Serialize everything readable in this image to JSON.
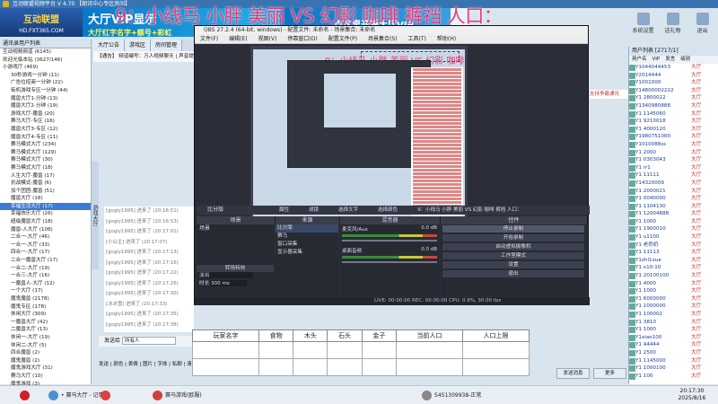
{
  "app": {
    "title": "互动联盟视频平台 V 4.70 【朗讯中心专区房间】"
  },
  "banner": {
    "logo": "互动联盟",
    "logo_sub": "HD.FXT365.COM",
    "ad1": "大厅VIP显示",
    "ad1_sub": "大厅红字名字+靓号+彩虹",
    "ad2": "点这里开通大厅VIP"
  },
  "overlay_caption": "9：小线马 小胖 美丽 VS 幻影 咖啡 裤裆 人口：",
  "top_tools": [
    {
      "label": "系统设置"
    },
    {
      "label": "送礼物"
    },
    {
      "label": "退出"
    }
  ],
  "tree": {
    "header": "通讯录用户列表",
    "rows": [
      "互动视频频道 (6145)",
      "欢迎光临本站 (3627/146)",
      "小游戏厅 (469)",
      "30秒游戏一分钟 (11)",
      "广告位招商一分钟 (22)",
      "街机游戏专区一分钟 (44)",
      "魔兽大厅1-分钟 (13)",
      "魔兽大厅2-分钟 (19)",
      "游戏大厅-魔兽 (20)",
      "赛马大厅-专区 (16)",
      "魔兽大厅3-专区 (12)",
      "魔兽大厅4-专区 (11)",
      "赛马模式大厅 (234)",
      "赛马模式大厅 (129)",
      "赛马模式大厅 (30)",
      "赛马模式大厅 (18)",
      "人生大厅-魔兽 (17)",
      "抗战模式-魔兽 (6)",
      "加个团团-魔兽 (51)",
      "魔兽大厅 (18)",
      "幸福生活大厅 (17)",
      "幸福快乐大厅 (26)",
      "超级魔兽大厅 (18)",
      "魔兽-人大厅 (106)",
      "二合一-大厅 (46)",
      "一合一-大厅 (33)",
      "四合一-大厅 (17)",
      "二合一魔兽大厅 (17)",
      "一合二-大厅 (19)",
      "一合三-大厅 (16)",
      "一魔兽人-大厅 (12)",
      "一个大厅 (17)",
      "魔鬼魔兽 (2178)",
      "魔鬼专区 (178)",
      "休闲大厅 (309)",
      "一魔兽大厅 (42)",
      "二魔兽大厅 (13)",
      "休闲一-大厅 (19)",
      "休闲二-大厅 (5)",
      "四合魔兽 (2)",
      "魔鬼魔兽 (2)",
      "魔鬼游戏大厅 (31)",
      "赛马大厅 (10)",
      "魔鬼游戏 (3)"
    ],
    "vertical_tab": "游戏大厅"
  },
  "tabs": [
    "大厅公告",
    "游戏区",
    "房间管理"
  ],
  "info_bar": "【通告】 频道编号：万人视频聊天 | 声音提示：轻声...",
  "chat_log": [
    "[gogly1995] 进来了 (20:16:51)",
    "[gogly1995] 进来了 (20:16:53)",
    "[gogly1995] 进来了 (20:17:01)",
    "[小公主] 进来了 (20:17:07)",
    "[gogly1995] 进来了 (20:17:13)",
    "[gogly1995] 进来了 (20:17:16)",
    "[gogly1995] 进来了 (20:17:22)",
    "[gogly1995] 进来了 (20:17:26)",
    "[gogly1995] 进来了 (20:17:30)",
    "[冰冰雪] 进来了 (20:17:33)",
    "[gogly1995] 进来了 (20:17:35)",
    "[gogly1995] 进来了 (20:17:38)"
  ],
  "chat_input": {
    "label": "发送给",
    "target": "所有人"
  },
  "chat_bottom": "发送 | 颜色 | 表情 | 图片 | 字体 | 私聊 | 清屏",
  "obs": {
    "title": "OBS 27.2.4 (64-bit, windows) - 配置文件: 未命名 - 场景集合: 未命名",
    "menu": [
      "文件(F)",
      "编辑(E)",
      "视图(V)",
      "停靠窗口(D)",
      "配置文件(P)",
      "场景集合(S)",
      "工具(T)",
      "帮助(H)"
    ],
    "source_label": "比分版",
    "props": [
      "属性",
      "滤镜",
      "选择文字",
      "选择颜色"
    ],
    "text_value": "9：小线马 小胖 美丽 VS 幻影 咖啡 裤裆 人口：",
    "docks": {
      "scenes": "场景",
      "sources": "来源",
      "mixer": "混音器",
      "controls": "控件"
    },
    "scenes": [
      "场景"
    ],
    "sources": [
      "比分版",
      "赛马",
      "窗口采集",
      "显示器采集"
    ],
    "mixer": [
      {
        "name": "麦克风/Aux",
        "db": "0.0 dB"
      },
      {
        "name": "桌面音频",
        "db": "0.0 dB"
      }
    ],
    "controls": [
      "停止录制",
      "开始录制",
      "启动虚拟摄像机",
      "工作室模式",
      "设置",
      "退出"
    ],
    "transition": {
      "head": "转场特效",
      "value": "淡出",
      "duration_label": "时长",
      "duration": "300 ms"
    },
    "status": "LIVE: 00:00:00   REC: 00:00:00   CPU: 0.9%, 30.00 fps"
  },
  "table": {
    "headers": [
      "玩家名字",
      "食物",
      "木头",
      "石头",
      "金子",
      "当前人口",
      "人口上限"
    ]
  },
  "right_panel": {
    "header": "用户列表 [2717/1]",
    "cols": [
      "用户名",
      "VIP",
      "发言",
      "级别"
    ],
    "notice": "支持争霸通讯",
    "users": [
      {
        "name": "Y1044044453",
        "tag": "大厅"
      },
      {
        "name": "Y2014444",
        "tag": "大厅"
      },
      {
        "name": "Y1001000",
        "tag": "大厅"
      },
      {
        "name": "Y14800002222",
        "tag": "大厅"
      },
      {
        "name": "Y1 2800022",
        "tag": "大厅"
      },
      {
        "name": "Y1340980888",
        "tag": "大厅"
      },
      {
        "name": "Y1 1145060",
        "tag": "大厅"
      },
      {
        "name": "Y1 9210018",
        "tag": "大厅"
      },
      {
        "name": "Y1 4000120",
        "tag": "大厅"
      },
      {
        "name": "Y1980751000",
        "tag": "大厅"
      },
      {
        "name": "Y1010088ss",
        "tag": "大厅"
      },
      {
        "name": "Y1 2000",
        "tag": "大厅"
      },
      {
        "name": "Y1 0303043",
        "tag": "大厅"
      },
      {
        "name": "Y1 rr1",
        "tag": "大厅"
      },
      {
        "name": "Y1 11111",
        "tag": "大厅"
      },
      {
        "name": "Y14320009",
        "tag": "大厅"
      },
      {
        "name": "Y1 2000021",
        "tag": "大厅"
      },
      {
        "name": "Y1 0040000",
        "tag": "大厅"
      },
      {
        "name": "Y1 1104130",
        "tag": "大厅"
      },
      {
        "name": "Y1 12004888",
        "tag": "大厅"
      },
      {
        "name": "Y1 1000",
        "tag": "大厅"
      },
      {
        "name": "Y1 1900010",
        "tag": "大厅"
      },
      {
        "name": "Y1 u1100",
        "tag": "大厅"
      },
      {
        "name": "Y1 老奶奶",
        "tag": "大厅"
      },
      {
        "name": "Y1 11113",
        "tag": "大厅"
      },
      {
        "name": "Y1zhi1xue",
        "tag": "大厅"
      },
      {
        "name": "Y1 x10-10",
        "tag": "大厅"
      },
      {
        "name": "Y1 20100100",
        "tag": "大厅"
      },
      {
        "name": "Y1 4000",
        "tag": "大厅"
      },
      {
        "name": "Y1 1000",
        "tag": "大厅"
      },
      {
        "name": "Y1 6000000",
        "tag": "大厅"
      },
      {
        "name": "Y1 1000000",
        "tag": "大厅"
      },
      {
        "name": "Y1 100002",
        "tag": "大厅"
      },
      {
        "name": "Y1 3810",
        "tag": "大厅"
      },
      {
        "name": "Y1 1000",
        "tag": "大厅"
      },
      {
        "name": "Y1xiao100",
        "tag": "大厅"
      },
      {
        "name": "Y1 44444",
        "tag": "大厅"
      },
      {
        "name": "Y1 2500",
        "tag": "大厅"
      },
      {
        "name": "Y1 1145000",
        "tag": "大厅"
      },
      {
        "name": "Y1 1000100",
        "tag": "大厅"
      },
      {
        "name": "Y1 100",
        "tag": "大厅"
      }
    ],
    "buttons": [
      "发送消息",
      "更多"
    ]
  },
  "taskbar": {
    "items": [
      {
        "label": "",
        "color": "#d02020"
      },
      {
        "label": "• 赛马大厅 - 记事本",
        "color": "#4a90d0"
      },
      {
        "label": "",
        "color": "#e04040"
      },
      {
        "label": "赛马游戏(欧服)",
        "color": "#d04040"
      },
      {
        "label": "5451309938-正常",
        "color": "#888"
      }
    ],
    "time": "20:17:30",
    "date": "2025/8/16"
  }
}
